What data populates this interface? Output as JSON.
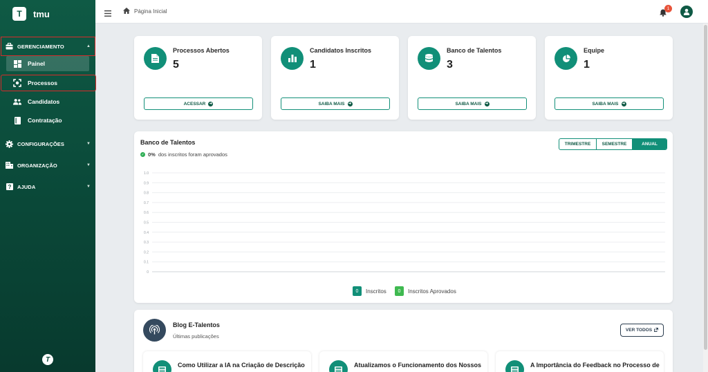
{
  "brand": {
    "logo_letter": "T",
    "name": "tmu"
  },
  "sidebar": {
    "sections": [
      {
        "label": "GERENCIAMENTO",
        "icon": "briefcase-icon",
        "expanded": true
      },
      {
        "label": "CONFIGURAÇÕES",
        "icon": "gear-icon",
        "expanded": false
      },
      {
        "label": "ORGANIZAÇÃO",
        "icon": "building-icon",
        "expanded": false
      },
      {
        "label": "AJUDA",
        "icon": "question-icon",
        "expanded": false
      }
    ],
    "items": [
      {
        "label": "Painel",
        "icon": "dashboard-icon",
        "active": true
      },
      {
        "label": "Processos",
        "icon": "process-icon",
        "active": false
      },
      {
        "label": "Candidatos",
        "icon": "users-icon",
        "active": false
      },
      {
        "label": "Contratação",
        "icon": "book-icon",
        "active": false
      }
    ],
    "footer_logo": "T"
  },
  "topbar": {
    "breadcrumb": "Página Inicial",
    "notification_count": "1"
  },
  "stats": [
    {
      "title": "Processos Abertos",
      "value": "5",
      "button": "ACESSAR",
      "icon": "document-icon"
    },
    {
      "title": "Candidatos Inscritos",
      "value": "1",
      "button": "SAIBA MAIS",
      "icon": "bar-chart-icon"
    },
    {
      "title": "Banco de Talentos",
      "value": "3",
      "button": "SAIBA MAIS",
      "icon": "database-icon"
    },
    {
      "title": "Equipe",
      "value": "1",
      "button": "SAIBA MAIS",
      "icon": "pie-chart-icon"
    }
  ],
  "talent_chart": {
    "title": "Banco de Talentos",
    "approval_percent": "0%",
    "approval_text": "dos inscritos foram aprovados",
    "periods": [
      "TRIMESTRE",
      "SEMESTRE",
      "ANUAL"
    ],
    "active_period": "ANUAL",
    "legend": [
      {
        "count": "0",
        "label": "Inscritos",
        "color": "#118f78"
      },
      {
        "count": "0",
        "label": "Inscritos Aprovados",
        "color": "#3fb950"
      }
    ]
  },
  "chart_data": {
    "type": "line",
    "title": "",
    "xlabel": "",
    "ylabel": "",
    "yticks": [
      "1.0",
      "0.9",
      "0.8",
      "0.7",
      "0.6",
      "0.5",
      "0.4",
      "0.3",
      "0.2",
      "0.1",
      "0"
    ],
    "ylim": [
      0,
      1
    ],
    "grid": true,
    "series": [
      {
        "name": "Inscritos",
        "values": []
      },
      {
        "name": "Inscritos Aprovados",
        "values": []
      }
    ]
  },
  "blog": {
    "title": "Blog E-Talentos",
    "subtitle": "Últimas publicações",
    "view_all": "VER TODOS",
    "posts": [
      {
        "title": "Como Utilizar a IA na Criação de Descrição"
      },
      {
        "title": "Atualizamos o Funcionamento dos Nossos"
      },
      {
        "title": "A Importância do Feedback no Processo de"
      }
    ]
  }
}
